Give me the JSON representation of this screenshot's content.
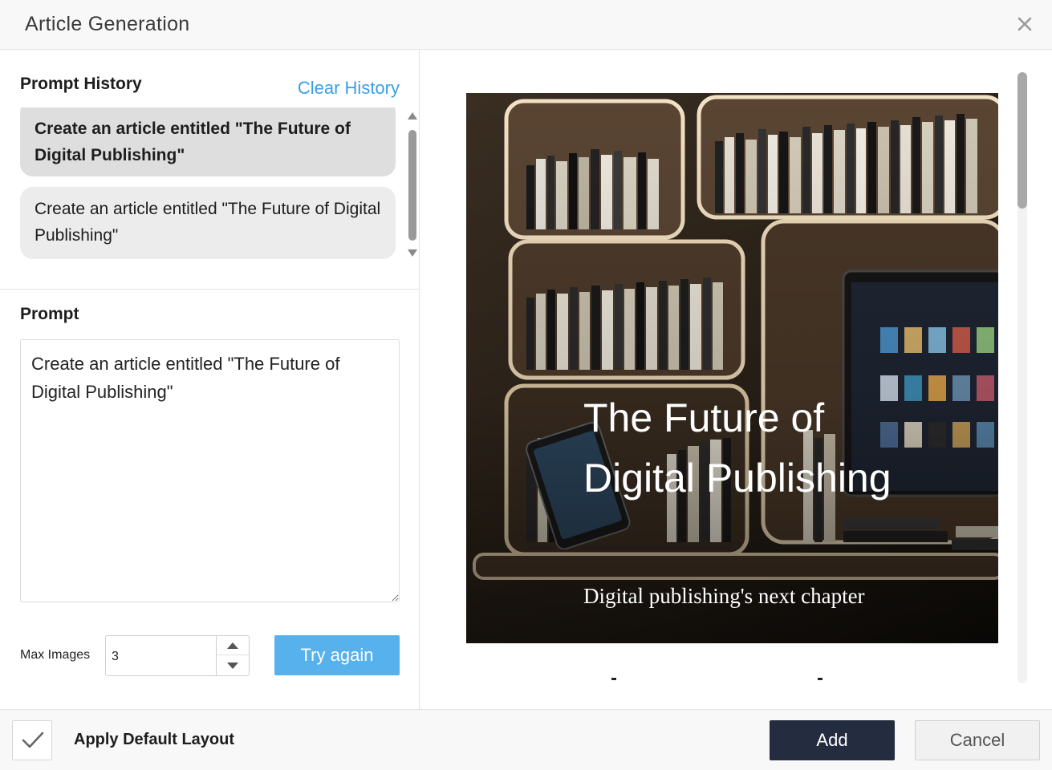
{
  "dialog": {
    "title": "Article Generation",
    "close_icon": "close-icon"
  },
  "history": {
    "title": "Prompt History",
    "clear_label": "Clear History",
    "items": [
      {
        "text": "Create an article entitled \"The Future of Digital Publishing\"",
        "selected": true
      },
      {
        "text": "Create an article entitled \"The Future of Digital Publishing\"",
        "selected": false
      }
    ]
  },
  "prompt": {
    "label": "Prompt",
    "value": "Create an article entitled \"The Future of Digital Publishing\""
  },
  "max_images": {
    "label": "Max Images",
    "value": "3"
  },
  "try_again_label": "Try again",
  "preview": {
    "title": "The Future of Digital Publishing",
    "subtitle": "Digital publishing's next chapter"
  },
  "footer": {
    "apply_default_layout_label": "Apply Default Layout",
    "apply_default_layout_checked": true,
    "add_label": "Add",
    "cancel_label": "Cancel"
  },
  "colors": {
    "accent": "#56b1ec",
    "link": "#3a9ee4",
    "primary_button": "#242c3f"
  }
}
